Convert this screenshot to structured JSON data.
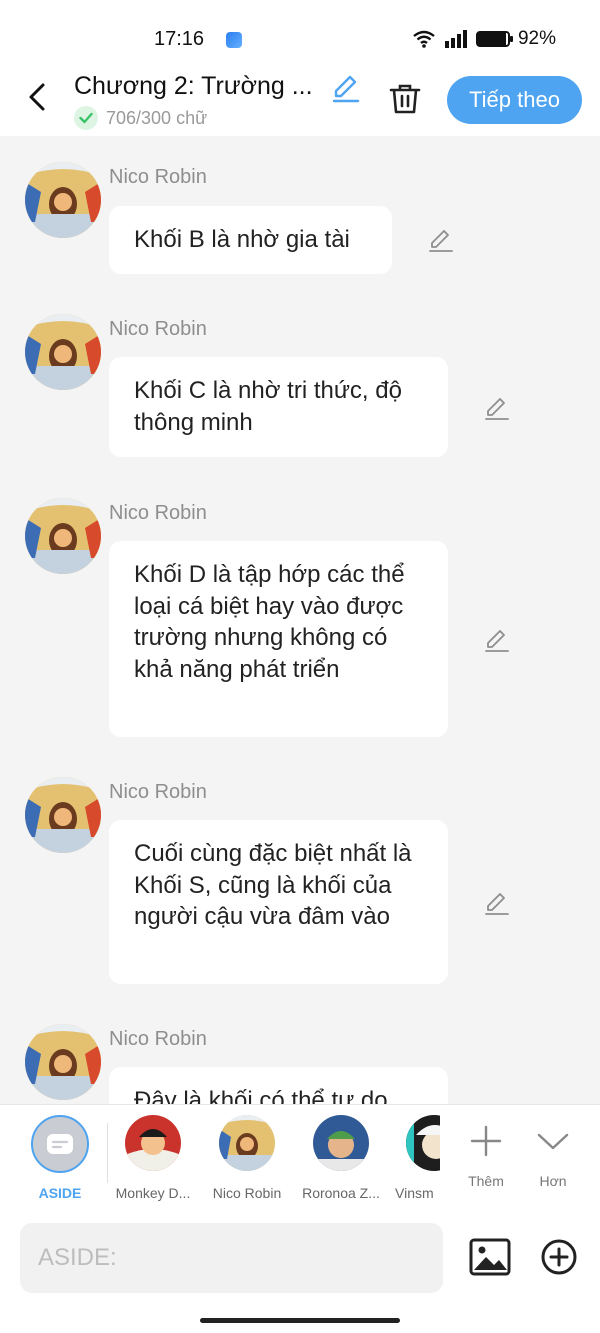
{
  "status_bar": {
    "time": "17:16",
    "battery_text": "92%",
    "battery_level": 0.92
  },
  "header": {
    "chapter_title": "Chương 2: Trường ...",
    "word_count": "706/300 chữ",
    "next_button": "Tiếp theo"
  },
  "messages": [
    {
      "sender": "Nico Robin",
      "text": "Khối B là nhờ gia tài"
    },
    {
      "sender": "Nico Robin",
      "text": "Khối C là nhờ tri thức, độ thông minh"
    },
    {
      "sender": "Nico Robin",
      "text": "Khối D là tập hớp các thể loại cá biệt hay vào được trường nhưng không có khả năng phát triển"
    },
    {
      "sender": "Nico Robin",
      "text": "Cuối cùng đặc biệt nhất là Khối S, cũng là khối của người cậu vừa đâm vào"
    },
    {
      "sender": "Nico Robin",
      "text": "Đây là khối có thể tự do"
    }
  ],
  "characters": [
    {
      "name": "ASIDE"
    },
    {
      "name": "Monkey D..."
    },
    {
      "name": "Nico Robin"
    },
    {
      "name": "Roronoa Z..."
    },
    {
      "name": "Vinsm"
    }
  ],
  "tools": {
    "add_label": "Thêm",
    "more_label": "Hơn"
  },
  "input": {
    "placeholder": "ASIDE:"
  },
  "colors": {
    "accent": "#4ea4f0",
    "background": "#f4f4f5",
    "success": "#3cc36a"
  },
  "icons": [
    "back-arrow-icon",
    "pencil-icon",
    "trash-icon",
    "check-icon",
    "plus-icon",
    "chevron-down-icon",
    "image-icon",
    "plus-circle-icon",
    "chat-bubble-icon"
  ]
}
